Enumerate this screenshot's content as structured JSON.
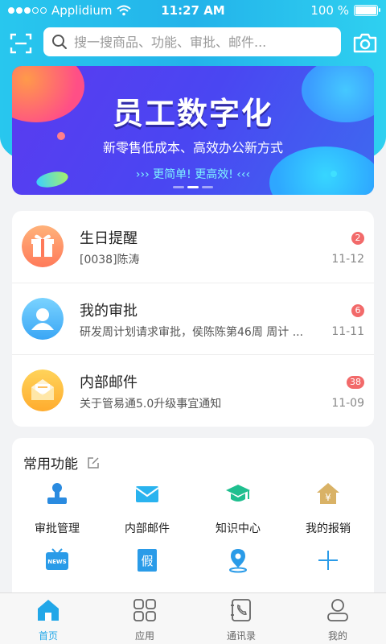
{
  "status_bar": {
    "carrier": "Applidium",
    "time": "11:27 AM",
    "battery": "100 %"
  },
  "search": {
    "placeholder": "搜一搜商品、功能、审批、邮件..."
  },
  "banner": {
    "title": "员工数字化",
    "subtitle": "新零售低成本、高效办公新方式",
    "slogan": "更简单! 更高效!"
  },
  "messages": [
    {
      "title": "生日提醒",
      "desc": "[0038]陈涛",
      "badge": "2",
      "date": "11-12",
      "icon": "gift-icon"
    },
    {
      "title": "我的审批",
      "desc": "研发周计划请求审批，侯陈陈第46周 周计 ...",
      "badge": "6",
      "date": "11-11",
      "icon": "user-icon"
    },
    {
      "title": "内部邮件",
      "desc": "关于管易通5.0升级事宜通知",
      "badge": "38",
      "date": "11-09",
      "icon": "envelope-icon"
    }
  ],
  "common_functions": {
    "title": "常用功能",
    "items": [
      {
        "label": "审批管理",
        "icon": "stamp-icon"
      },
      {
        "label": "内部邮件",
        "icon": "mail-icon"
      },
      {
        "label": "知识中心",
        "icon": "graduation-cap-icon"
      },
      {
        "label": "我的报销",
        "icon": "yuan-house-icon"
      },
      {
        "label": "",
        "icon": "news-tv-icon",
        "icon_text": "NEWS"
      },
      {
        "label": "",
        "icon": "fake-tag-icon",
        "icon_text": "假"
      },
      {
        "label": "",
        "icon": "map-pin-icon"
      },
      {
        "label": "",
        "icon": "plus-icon"
      }
    ]
  },
  "tabbar": [
    {
      "label": "首页",
      "icon": "home-icon",
      "active": true
    },
    {
      "label": "应用",
      "icon": "apps-icon",
      "active": false
    },
    {
      "label": "通讯录",
      "icon": "contacts-icon",
      "active": false
    },
    {
      "label": "我的",
      "icon": "profile-icon",
      "active": false
    }
  ],
  "colors": {
    "accent": "#22a7e8",
    "header": "#28c7ee",
    "badge": "#f26a6a",
    "banner": "#4a46f2"
  }
}
